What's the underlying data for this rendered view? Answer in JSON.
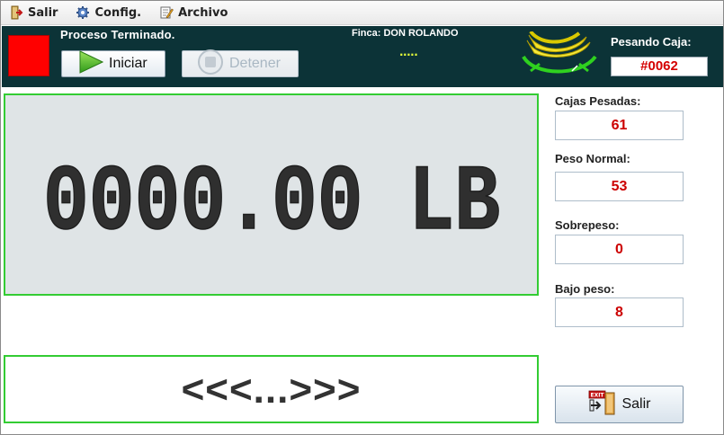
{
  "menu": {
    "items": [
      {
        "label": "Salir",
        "icon": "exit-icon"
      },
      {
        "label": "Config.",
        "icon": "gear-icon"
      },
      {
        "label": "Archivo",
        "icon": "document-edit-icon"
      }
    ]
  },
  "header": {
    "process_status": "Proceso Terminado.",
    "status_color": "#ff0000",
    "start_button": "Iniciar",
    "stop_button": "Detener",
    "finca_label": "Finca: DON ROLANDO",
    "finca_value": ".....",
    "weighing_box_label": "Pesando Caja:",
    "weighing_box_number": "#0062"
  },
  "scale": {
    "weight_reading": "0000.00 LB"
  },
  "message": {
    "text": "<<<...>>>"
  },
  "stats": {
    "boxes_weighed_label": "Cajas Pesadas:",
    "boxes_weighed_value": "61",
    "normal_weight_label": "Peso Normal:",
    "normal_weight_value": "53",
    "overweight_label": "Sobrepeso:",
    "overweight_value": "0",
    "underweight_label": "Bajo peso:",
    "underweight_value": "8"
  },
  "footer": {
    "exit_button": "Salir"
  },
  "colors": {
    "header_bg": "#0c3337",
    "panel_border": "#33cc33",
    "value_red": "#cc0000",
    "finca_dots": "#e8ff3a"
  }
}
